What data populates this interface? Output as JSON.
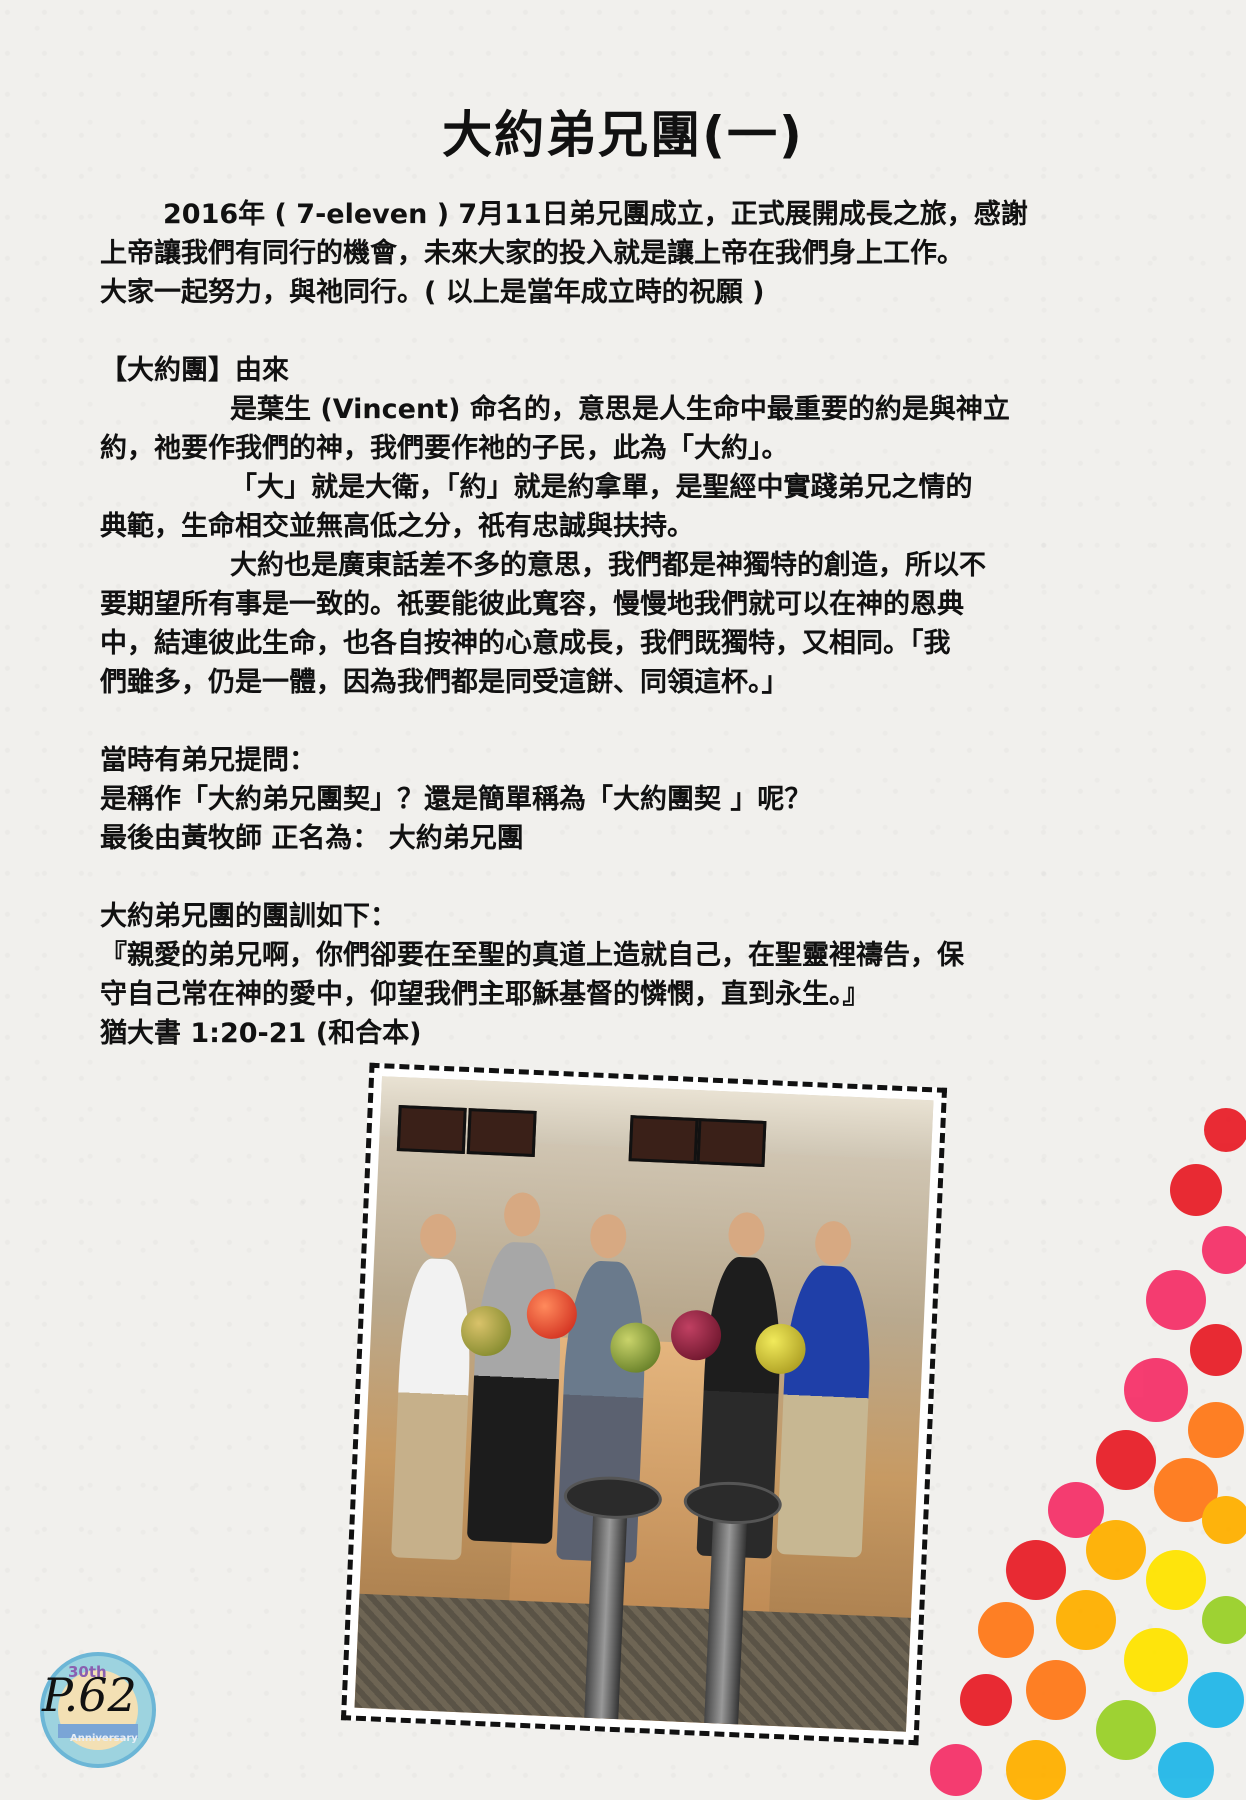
{
  "title": "大約弟兄團(一)",
  "intro": [
    "2016年 ( 7-eleven ) 7月11日弟兄團成立，正式展開成長之旅，感謝",
    "上帝讓我們有同行的機會，未來大家的投入就是讓上帝在我們身上工作。",
    "大家一起努力，與祂同行。( 以上是當年成立時的祝願 )"
  ],
  "origin": {
    "heading": "【大約團】由來",
    "para1": [
      "是葉生 (Vincent) 命名的，意思是人生命中最重要的約是與神立",
      "約，祂要作我們的神，我們要作祂的子民，此為「大約」。"
    ],
    "para2": [
      "「大」就是大衛，「約」就是約拿單，是聖經中實踐弟兄之情的",
      "典範，生命相交並無高低之分，祇有忠誠與扶持。"
    ],
    "para3": [
      "大約也是廣東話差不多的意思，我們都是神獨特的創造，所以不",
      "要期望所有事是一致的。祇要能彼此寬容，慢慢地我們就可以在神的恩典",
      "中，結連彼此生命，也各自按神的心意成長，我們既獨特，又相同。「我",
      "們雖多，仍是一體，因為我們都是同受這餅、同領這杯。」"
    ]
  },
  "naming": [
    "當時有弟兄提問：",
    "是稱作「大約弟兄團契」？還是簡單稱為「大約團契 」呢？",
    "最後由黃牧師 正名為：   大約弟兄團"
  ],
  "motto": [
    "大約弟兄團的團訓如下：",
    "『親愛的弟兄啊，你們卻要在至聖的真道上造就自己，在聖靈裡禱告，保",
    "守自己常在神的愛中，仰望我們主耶穌基督的憐憫，直到永生。』",
    "猶大書 1:20-21 (和合本)"
  ],
  "logo": {
    "page_number": "P.62",
    "badge_top": "30th",
    "badge_bottom": "Anniversary"
  },
  "colors": {
    "text": "#111111",
    "background": "#f1f0ed",
    "hand_colors": [
      "#e8202a",
      "#f5336a",
      "#ff7a1a",
      "#ffb000",
      "#ffe400",
      "#9ad12a",
      "#23b8e8"
    ]
  }
}
